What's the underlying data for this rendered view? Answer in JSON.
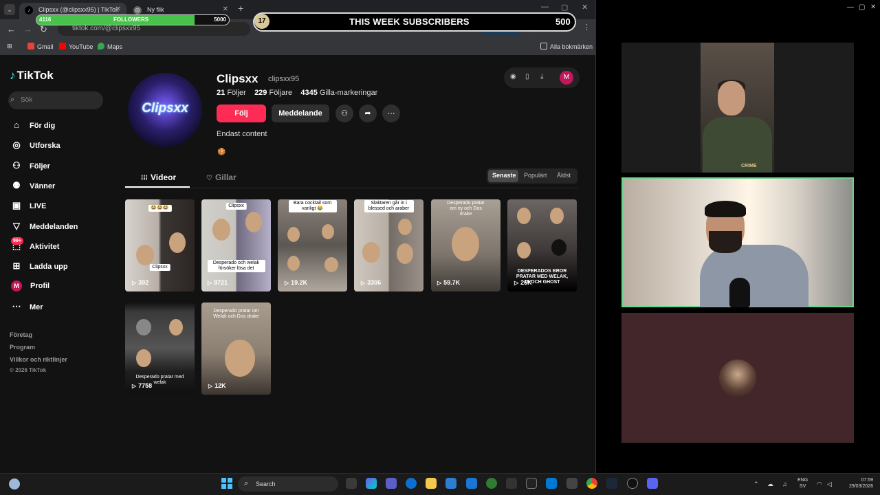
{
  "browser": {
    "tabs": [
      {
        "title": "Clipsxx (@clipsxx95) | TikTok"
      },
      {
        "title": "Ny flik"
      }
    ],
    "url": "tiktok.com/@clipsxx95",
    "install_label": "Installera",
    "bookmarks": [
      "Gmail",
      "YouTube",
      "Maps"
    ],
    "all_bookmarks": "Alla bokmärken"
  },
  "overlay": {
    "followers_current": "4116",
    "followers_label": "FOLLOWERS",
    "followers_goal": "5000",
    "followers_progress": 0.8232,
    "subs_count": "17",
    "subs_title": "THIS WEEK SUBSCRIBERS",
    "subs_goal": "500"
  },
  "sidebar": {
    "logo": "TikTok",
    "search_placeholder": "Sök",
    "nav": [
      {
        "label": "För dig",
        "icon": "home-icon"
      },
      {
        "label": "Utforska",
        "icon": "compass-icon"
      },
      {
        "label": "Följer",
        "icon": "following-icon"
      },
      {
        "label": "Vänner",
        "icon": "friends-icon"
      },
      {
        "label": "LIVE",
        "icon": "live-icon"
      },
      {
        "label": "Meddelanden",
        "icon": "send-icon"
      },
      {
        "label": "Aktivitet",
        "icon": "activity-icon"
      },
      {
        "label": "Ladda upp",
        "icon": "upload-icon"
      },
      {
        "label": "Profil",
        "icon": "profile-avatar-icon"
      },
      {
        "label": "Mer",
        "icon": "more-icon"
      }
    ],
    "activity_badge": "99+",
    "profile_initial": "M",
    "footer": [
      "Företag",
      "Program",
      "Villkor och riktlinjer"
    ],
    "copyright": "© 2026 TikTok"
  },
  "profile": {
    "avatar_text": "Clipsxx",
    "name": "Clipsxx",
    "handle": "clipsxx95",
    "following_count": "21",
    "following_label": "Följer",
    "followers_count": "229",
    "followers_label": "Följare",
    "likes_count": "4345",
    "likes_label": "Gilla-markeringar",
    "follow_button": "Följ",
    "message_button": "Meddelande",
    "bio": "Endast content",
    "bio_emoji": "🍪",
    "user_initial": "M"
  },
  "content_tabs": {
    "videos": "Videor",
    "likes": "Gillar"
  },
  "sort": {
    "options": [
      "Senaste",
      "Populärt",
      "Äldst"
    ],
    "selected": "Senaste"
  },
  "videos": [
    {
      "views": "392",
      "caption": "😂😂😂",
      "caption2": "Clipsxx"
    },
    {
      "views": "8721",
      "caption": "Clipsxx",
      "caption2": "Desperado och welak försöker lösa det"
    },
    {
      "views": "19.2K",
      "caption": "Bara cocktail som vanligt 😂"
    },
    {
      "views": "3306",
      "caption": "Slaktaren går in i blessed och araber"
    },
    {
      "views": "59.7K",
      "caption": "Desperado pratar om ey och Dos drake"
    },
    {
      "views": "26K",
      "caption": "DESPERADOS BROR PRATAR MED WELAK, 19 OCH GHOST"
    },
    {
      "views": "7758",
      "caption": "Desperado pratar med welak"
    },
    {
      "views": "12K",
      "caption": "Desperado pratar om Welak och Dos drake"
    }
  ],
  "taskbar": {
    "search_label": "Search",
    "lang_top": "ENG",
    "lang_bottom": "SV",
    "time": "07:59",
    "date": "29/03/2026"
  },
  "webcam": {
    "shirt_text": "CRIME"
  }
}
